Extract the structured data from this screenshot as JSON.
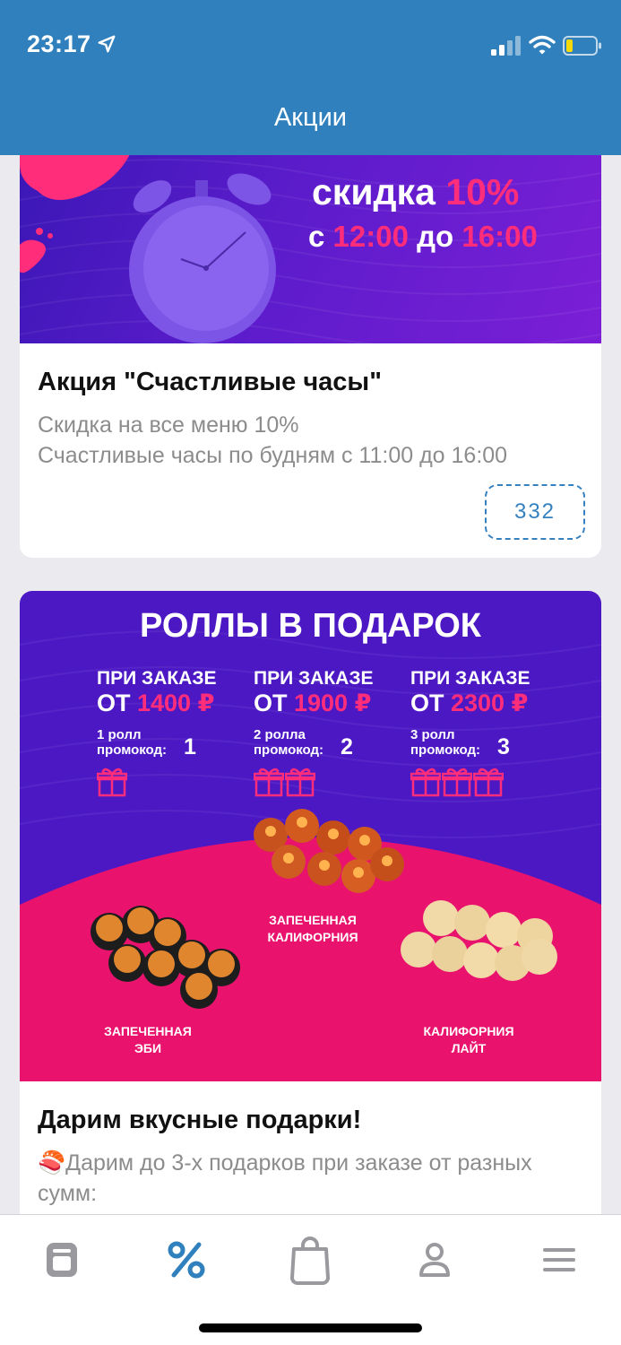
{
  "status_bar": {
    "time": "23:17"
  },
  "nav": {
    "title": "Акции"
  },
  "promos": [
    {
      "banner": {
        "line1_text": "скидка ",
        "line1_accent": "10%",
        "line2_pre": "с ",
        "line2_from": "12:00",
        "line2_mid": " до ",
        "line2_to": "16:00"
      },
      "title": "Акция \"Счастливые часы\"",
      "description": "Скидка на все меню 10%\nСчастливые часы по будням с 11:00 до 16:00",
      "code": "332"
    },
    {
      "banner": {
        "title": "РОЛЛЫ В ПОДАРОК",
        "tiers": [
          {
            "head": "ПРИ ЗАКАЗЕ",
            "from": "ОТ ",
            "amount": "1400 ₽",
            "rolls": "1 ролл",
            "promo_label": "промокод:",
            "code": "1",
            "gifts": 1
          },
          {
            "head": "ПРИ ЗАКАЗЕ",
            "from": "ОТ ",
            "amount": "1900 ₽",
            "rolls": "2 ролла",
            "promo_label": "промокод:",
            "code": "2",
            "gifts": 2
          },
          {
            "head": "ПРИ ЗАКАЗЕ",
            "from": "ОТ ",
            "amount": "2300 ₽",
            "rolls": "3 ролл",
            "promo_label": "промокод:",
            "code": "3",
            "gifts": 3
          }
        ],
        "rolls": [
          {
            "line1": "ЗАПЕЧЕННАЯ",
            "line2": "КАЛИФОРНИЯ"
          },
          {
            "line1": "ЗАПЕЧЕННАЯ",
            "line2": "ЭБИ"
          },
          {
            "line1": "КАЛИФОРНИЯ",
            "line2": "ЛАЙТ"
          }
        ]
      },
      "title": "Дарим вкусные подарки!",
      "description_emoji": "🍣",
      "description": "Дарим до 3-х подарков при заказе от разных сумм:"
    }
  ],
  "tab_bar": {
    "tabs": [
      {
        "icon": "menu-card-icon",
        "active": false
      },
      {
        "icon": "percent-icon",
        "active": true
      },
      {
        "icon": "shopping-bag-icon",
        "active": false
      },
      {
        "icon": "profile-icon",
        "active": false
      },
      {
        "icon": "hamburger-icon",
        "active": false
      }
    ]
  },
  "colors": {
    "header": "#2f80bc",
    "accent_pink": "#ff2d7a",
    "banner_purple": "#4c18c4",
    "tab_active": "#2f80bc",
    "tab_inactive": "#9a9a9e"
  }
}
